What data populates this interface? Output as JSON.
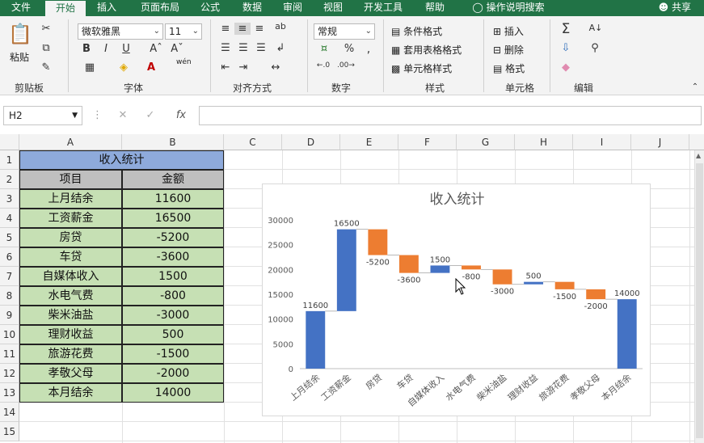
{
  "tabs": [
    "文件",
    "开始",
    "插入",
    "页面布局",
    "公式",
    "数据",
    "审阅",
    "视图",
    "开发工具",
    "帮助",
    "操作说明搜索"
  ],
  "share": "共享",
  "ribbon": {
    "paste": "粘贴",
    "font_name": "微软雅黑",
    "font_size": "11",
    "wen": "wén",
    "number_format": "常规",
    "conditional": "条件格式",
    "table_format": "套用表格格式",
    "cell_style": "单元格样式",
    "insert": "插入",
    "delete": "删除",
    "format": "格式",
    "groups": [
      "剪贴板",
      "字体",
      "对齐方式",
      "数字",
      "样式",
      "单元格",
      "编辑"
    ]
  },
  "namebox": "H2",
  "fx": "fx",
  "columns": [
    "A",
    "B",
    "C",
    "D",
    "E",
    "F",
    "G",
    "H",
    "I",
    "J"
  ],
  "rows": [
    "1",
    "2",
    "3",
    "4",
    "5",
    "6",
    "7",
    "8",
    "9",
    "10",
    "11",
    "12",
    "13",
    "14",
    "15"
  ],
  "sheet": {
    "title": "收入统计",
    "header_item": "项目",
    "header_amount": "金额",
    "items": [
      "上月结余",
      "工资薪金",
      "房贷",
      "车贷",
      "自媒体收入",
      "水电气费",
      "柴米油盐",
      "理财收益",
      "旅游花费",
      "孝敬父母",
      "本月结余"
    ],
    "amounts": [
      "11600",
      "16500",
      "-5200",
      "-3600",
      "1500",
      "-800",
      "-3000",
      "500",
      "-1500",
      "-2000",
      "14000"
    ]
  },
  "chart_data": {
    "type": "bar",
    "subtype": "waterfall",
    "title": "收入统计",
    "categories": [
      "上月结余",
      "工资薪金",
      "房贷",
      "车贷",
      "自媒体收入",
      "水电气费",
      "柴米油盐",
      "理财收益",
      "旅游花费",
      "孝敬父母",
      "本月结余"
    ],
    "values": [
      11600,
      16500,
      -5200,
      -3600,
      1500,
      -800,
      -3000,
      500,
      -1500,
      -2000,
      14000
    ],
    "labels": [
      "11600",
      "16500",
      "-5200",
      "-3600",
      "1500",
      "-800",
      "-3000",
      "500",
      "-1500",
      "-2000",
      "14000"
    ],
    "totals": [
      true,
      false,
      false,
      false,
      false,
      false,
      false,
      false,
      false,
      false,
      true
    ],
    "ylim": [
      0,
      30000
    ],
    "yticks": [
      "0",
      "5000",
      "10000",
      "15000",
      "20000",
      "25000",
      "30000"
    ],
    "colors": {
      "increase": "#4472c4",
      "decrease": "#ed7d31",
      "total": "#4472c4"
    },
    "grid": false,
    "legend": "none"
  },
  "colors": {
    "accent": "#217346",
    "title_fill": "#8eaadb",
    "header_fill": "#bfbfbf",
    "data_fill": "#c6e0b4"
  }
}
